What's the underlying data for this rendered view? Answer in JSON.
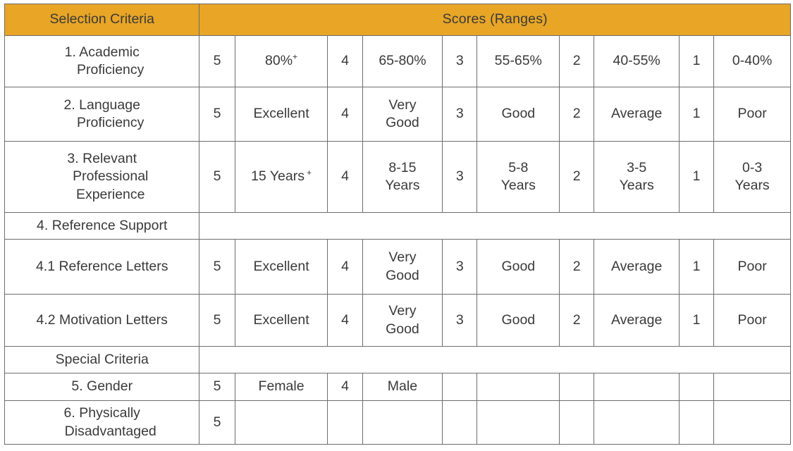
{
  "table": {
    "header": {
      "criteria_label": "Selection Criteria",
      "scores_label": "Scores (Ranges)"
    },
    "accent_color": "#E8A526",
    "border_color": "#6E6E6E",
    "text_color": "#4A4A4A",
    "columns": [
      "Selection Criteria",
      "Score 5",
      "Range 5",
      "Score 4",
      "Range 4",
      "Score 3",
      "Range 3",
      "Score 2",
      "Range 2",
      "Score 1",
      "Range 1"
    ],
    "rows": [
      {
        "type": "criteria",
        "label_line1": "1. Academic",
        "label_line2": "Proficiency",
        "cells": [
          {
            "score": "5",
            "range": "80%",
            "sup": "+"
          },
          {
            "score": "4",
            "range": "65-80%",
            "sup": ""
          },
          {
            "score": "3",
            "range": "55-65%",
            "sup": ""
          },
          {
            "score": "2",
            "range": "40-55%",
            "sup": ""
          },
          {
            "score": "1",
            "range": "0-40%",
            "sup": ""
          }
        ]
      },
      {
        "type": "criteria",
        "label_line1": "2. Language",
        "label_line2": "Proficiency",
        "cells": [
          {
            "score": "5",
            "range": "Excellent",
            "range2": ""
          },
          {
            "score": "4",
            "range": "Very",
            "range2": "Good"
          },
          {
            "score": "3",
            "range": "Good",
            "range2": ""
          },
          {
            "score": "2",
            "range": "Average",
            "range2": ""
          },
          {
            "score": "1",
            "range": "Poor",
            "range2": ""
          }
        ]
      },
      {
        "type": "criteria",
        "label_line1": "3. Relevant",
        "label_line2": "Professional",
        "label_line3": "Experience",
        "cells": [
          {
            "score": "5",
            "range": "15 Years",
            "sup": "+"
          },
          {
            "score": "4",
            "range": "8-15",
            "range2": "Years"
          },
          {
            "score": "3",
            "range": "5-8",
            "range2": "Years"
          },
          {
            "score": "2",
            "range": "3-5",
            "range2": "Years"
          },
          {
            "score": "1",
            "range": "0-3",
            "range2": "Years"
          }
        ]
      },
      {
        "type": "section",
        "label_line1": "4. Reference Support"
      },
      {
        "type": "criteria",
        "label_line1": "4.1 Reference Letters",
        "cells": [
          {
            "score": "5",
            "range": "Excellent",
            "range2": ""
          },
          {
            "score": "4",
            "range": "Very",
            "range2": "Good"
          },
          {
            "score": "3",
            "range": "Good",
            "range2": ""
          },
          {
            "score": "2",
            "range": "Average",
            "range2": ""
          },
          {
            "score": "1",
            "range": "Poor",
            "range2": ""
          }
        ]
      },
      {
        "type": "criteria",
        "label_line1": "4.2 Motivation Letters",
        "cells": [
          {
            "score": "5",
            "range": "Excellent",
            "range2": ""
          },
          {
            "score": "4",
            "range": "Very",
            "range2": "Good"
          },
          {
            "score": "3",
            "range": "Good",
            "range2": ""
          },
          {
            "score": "2",
            "range": "Average",
            "range2": ""
          },
          {
            "score": "1",
            "range": "Poor",
            "range2": ""
          }
        ]
      },
      {
        "type": "section",
        "label_line1": "Special Criteria"
      },
      {
        "type": "criteria",
        "label_line1": "5. Gender",
        "cells": [
          {
            "score": "5",
            "range": "Female",
            "range2": ""
          },
          {
            "score": "4",
            "range": "Male",
            "range2": ""
          },
          {
            "score": "",
            "range": "",
            "range2": ""
          },
          {
            "score": "",
            "range": "",
            "range2": ""
          },
          {
            "score": "",
            "range": "",
            "range2": ""
          }
        ]
      },
      {
        "type": "criteria",
        "label_line1": "6. Physically",
        "label_line2": "Disadvantaged",
        "cells": [
          {
            "score": "5",
            "range": "",
            "range2": ""
          },
          {
            "score": "",
            "range": "",
            "range2": ""
          },
          {
            "score": "",
            "range": "",
            "range2": ""
          },
          {
            "score": "",
            "range": "",
            "range2": ""
          },
          {
            "score": "",
            "range": "",
            "range2": ""
          }
        ]
      }
    ]
  }
}
